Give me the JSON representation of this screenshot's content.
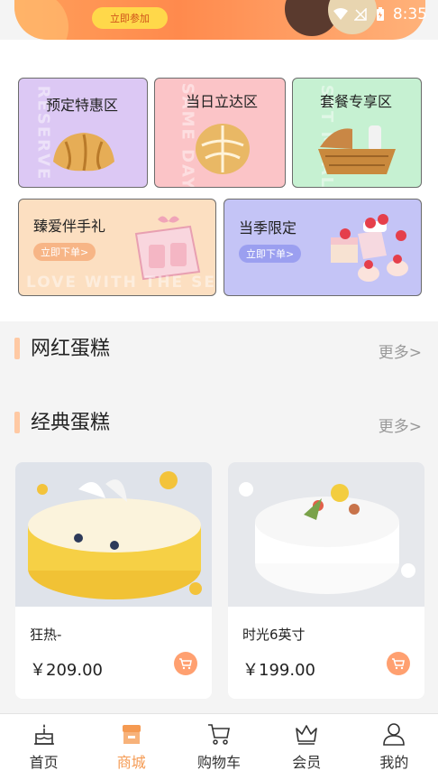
{
  "status_bar": {
    "time": "8:35"
  },
  "banner": {
    "join_label": "立即参加"
  },
  "categories": [
    {
      "title": "预定特惠区",
      "ghost": "RESERVE",
      "bg": "#dcc8f4"
    },
    {
      "title": "当日立达区",
      "ghost": "SAME DAY",
      "bg": "#fbc4c7"
    },
    {
      "title": "套餐专享区",
      "ghost": "SET MEAL",
      "bg": "#c6f1d2"
    }
  ],
  "promos": [
    {
      "title": "臻爱伴手礼",
      "button": "立即下单>",
      "bg": "#fcdfc1",
      "btn_color": "#f7b586"
    },
    {
      "title": "当季限定",
      "button": "立即下单>",
      "bg": "#c4c4f6",
      "btn_color": "#9b9ff0"
    }
  ],
  "promo_ghost": "LOVE WITH THE SEASONAL LIMITED",
  "sections": [
    {
      "title": "网红蛋糕",
      "more": "更多>"
    },
    {
      "title": "经典蛋糕",
      "more": "更多>"
    }
  ],
  "products": [
    {
      "name": "狂热-",
      "price": "￥209.00"
    },
    {
      "name": "时光6英寸",
      "price": "￥199.00"
    }
  ],
  "nav": [
    {
      "label": "首页",
      "icon": "cake-icon",
      "active": false
    },
    {
      "label": "商城",
      "icon": "store-icon",
      "active": true
    },
    {
      "label": "购物车",
      "icon": "cart-icon",
      "active": false
    },
    {
      "label": "会员",
      "icon": "crown-icon",
      "active": false
    },
    {
      "label": "我的",
      "icon": "user-icon",
      "active": false
    }
  ],
  "colors": {
    "accent": "#f59a52",
    "cart_button": "#ffa070",
    "section_bar": "#ffc9a3"
  }
}
